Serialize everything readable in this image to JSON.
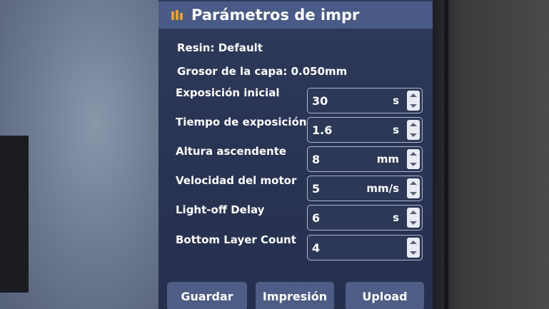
{
  "header": {
    "title": "Parámetros de impr",
    "icon": "settings-bars-icon",
    "accent": "#e2a23a"
  },
  "info": {
    "resin": "Resin: Default",
    "layer_thickness": "Grosor de la capa: 0.050mm"
  },
  "params": [
    {
      "label": "Exposición inicial",
      "value": "30",
      "unit": "s"
    },
    {
      "label": "Tiempo de exposición",
      "value": "1.6",
      "unit": "s"
    },
    {
      "label": "Altura ascendente",
      "value": "8",
      "unit": "mm"
    },
    {
      "label": "Velocidad del motor",
      "value": "5",
      "unit": "mm/s"
    },
    {
      "label": "Light-off Delay",
      "value": "6",
      "unit": "s"
    },
    {
      "label": "Bottom Layer Count",
      "value": "4",
      "unit": ""
    }
  ],
  "buttons": {
    "save": "Guardar",
    "print": "Impresión",
    "upload": "Upload"
  },
  "colors": {
    "screen_bg": "#2a3454",
    "header_bg": "#4a5a86",
    "button_bg": "#4e5d85"
  }
}
